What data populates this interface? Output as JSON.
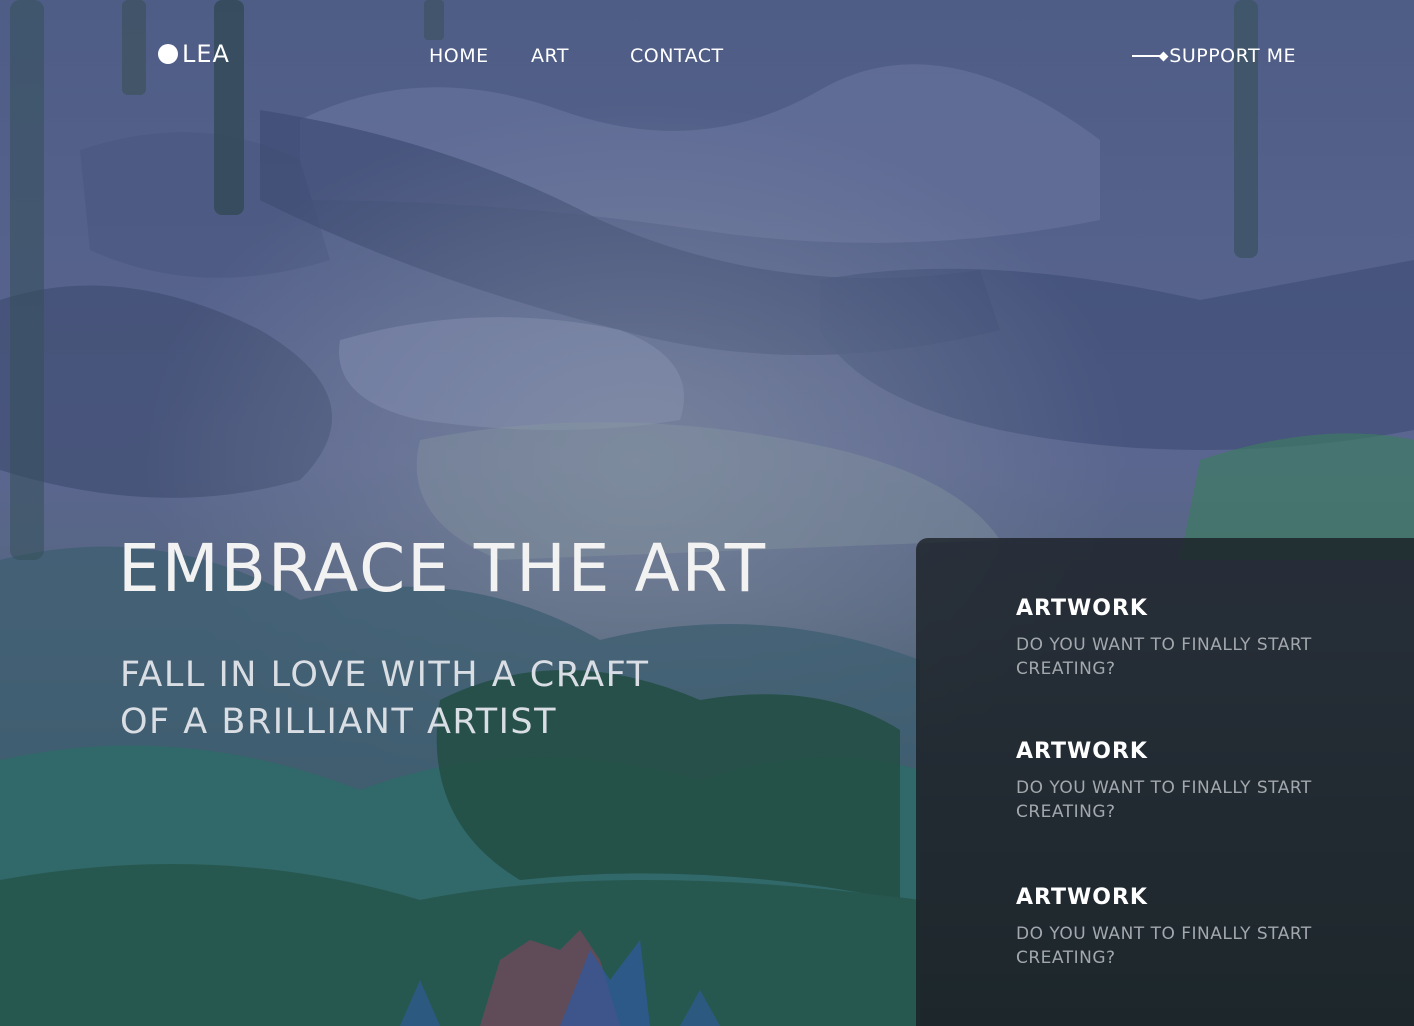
{
  "header": {
    "logo_text": "LEA",
    "nav": [
      {
        "label": "HOME"
      },
      {
        "label": "ART"
      },
      {
        "label": "CONTACT"
      }
    ],
    "support_label": "SUPPORT ME"
  },
  "hero": {
    "title": "EMBRACE THE ART",
    "subtitle": "FALL IN LOVE WITH A CRAFT OF A BRILLIANT ARTIST"
  },
  "panel": {
    "cards": [
      {
        "title": "ARTWORK",
        "description": "DO YOU WANT TO FINALLY START CREATING?"
      },
      {
        "title": "ARTWORK",
        "description": "DO YOU WANT TO FINALLY START CREATING?"
      },
      {
        "title": "ARTWORK",
        "description": "DO YOU WANT TO FINALLY START CREATING?"
      }
    ]
  },
  "colors": {
    "text_primary": "#ffffff",
    "panel_bg": "#181e22",
    "card_desc": "#a3a8ad",
    "sky": "#55648c",
    "foliage": "#2e5a52"
  }
}
